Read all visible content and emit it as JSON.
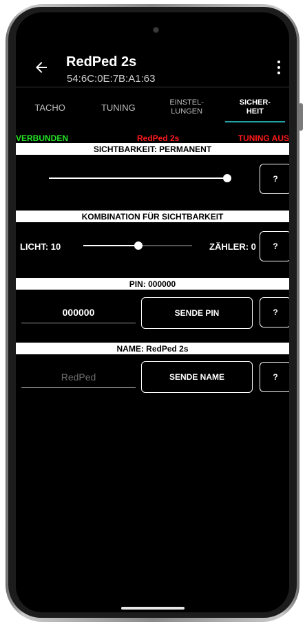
{
  "app": {
    "title": "RedPed 2s",
    "subtitle": "54:6C:0E:7B:A1:63"
  },
  "tabs": [
    {
      "label": "TACHO"
    },
    {
      "label": "TUNING"
    },
    {
      "label": "EINSTEL-\nLUNGEN"
    },
    {
      "label": "SICHER-\nHEIT"
    }
  ],
  "status": {
    "connection": "VERBUNDEN",
    "device": "RedPed 2s",
    "tuning": "TUNING AUS"
  },
  "visibility": {
    "header": "SICHTBARKEIT: PERMANENT",
    "help_label": "?"
  },
  "combination": {
    "header": "KOMBINATION FÜR SICHTBARKEIT",
    "light_label": "LICHT: 10",
    "counter_label": "ZÄHLER: 0",
    "help_label": "?"
  },
  "pin": {
    "header": "PIN: 000000",
    "input_value": "000000",
    "send_label": "SENDE PIN",
    "help_label": "?"
  },
  "name": {
    "header": "NAME: RedPed 2s",
    "input_placeholder": "RedPed",
    "send_label": "SENDE NAME",
    "help_label": "?"
  },
  "colors": {
    "connected": "#26e626",
    "alert": "#ff1a1a",
    "tab_indicator": "#1fa3a3"
  }
}
